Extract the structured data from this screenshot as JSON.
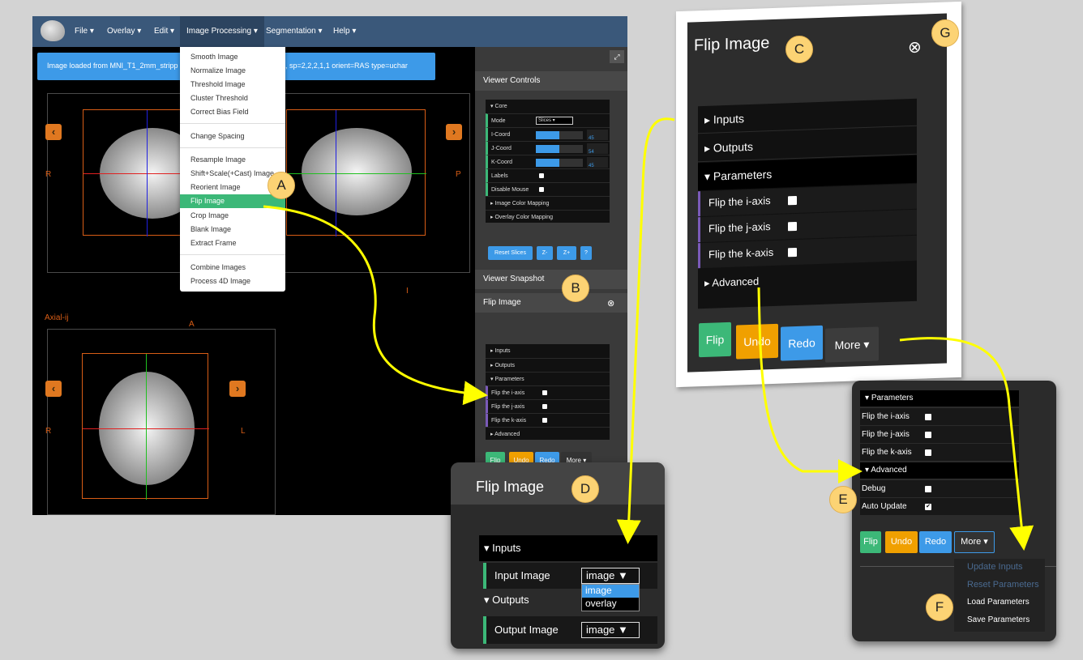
{
  "navbar": {
    "menus": [
      "File",
      "Overlay",
      "Edit",
      "Image Processing",
      "Segmentation",
      "Help"
    ]
  },
  "alert": {
    "text": "Image loaded from MNI_T1_2mm_stripp",
    "text2": ", sp=2,2,2,1,1 orient=RAS type=uchar",
    "close": "×"
  },
  "menu": {
    "group1": [
      "Smooth Image",
      "Normalize Image",
      "Threshold Image",
      "Cluster Threshold",
      "Correct Bias Field"
    ],
    "group2": [
      "Change Spacing"
    ],
    "group3": [
      "Resample Image",
      "Shift+Scale(+Cast) Image",
      "Reorient Image",
      "Flip Image",
      "Crop Image",
      "Blank Image",
      "Extract Frame"
    ],
    "group4": [
      "Combine Images",
      "Process 4D Image"
    ]
  },
  "viewer": {
    "labels": {
      "coronal_left": "R",
      "sagittal_right": "P",
      "sagittal_bottom": "I",
      "axial_title": "Axial-ij",
      "axial_top": "A",
      "axial_left": "R",
      "axial_right": "L"
    }
  },
  "viewer_controls": {
    "title": "Viewer Controls",
    "core": "Core",
    "mode_label": "Mode",
    "mode_value": "Slices",
    "icoord": "I-Coord",
    "jcoord": "J-Coord",
    "kcoord": "K-Coord",
    "ival": "45",
    "jval": "54",
    "kval": "45",
    "labels": "Labels",
    "disable_mouse": "Disable Mouse",
    "image_color": "Image Color Mapping",
    "overlay_color": "Overlay Color Mapping",
    "reset_slices": "Reset Slices",
    "zminus": "Z-",
    "zplus": "Z+",
    "help": "?"
  },
  "snapshot": {
    "title": "Viewer Snapshot"
  },
  "flip_panel": {
    "title": "Flip Image",
    "inputs": "Inputs",
    "outputs": "Outputs",
    "parameters": "Parameters",
    "flip_i": "Flip the i-axis",
    "flip_j": "Flip the j-axis",
    "flip_k": "Flip the k-axis",
    "advanced": "Advanced",
    "flip_btn": "Flip",
    "undo": "Undo",
    "redo": "Redo",
    "more": "More"
  },
  "callout_d": {
    "title": "Flip Image",
    "inputs": "Inputs",
    "input_image": "Input Image",
    "input_value": "image",
    "options": [
      "image",
      "overlay"
    ],
    "outputs": "Outputs",
    "output_image": "Output Image",
    "output_value": "image"
  },
  "callout_ef": {
    "parameters": "Parameters",
    "flip_i": "Flip the i-axis",
    "flip_j": "Flip the j-axis",
    "flip_k": "Flip the k-axis",
    "advanced": "Advanced",
    "debug": "Debug",
    "auto_update": "Auto Update",
    "flip_btn": "Flip",
    "undo": "Undo",
    "redo": "Redo",
    "more": "More",
    "more_menu": [
      "Update Inputs",
      "Reset Parameters",
      "Load Parameters",
      "Save Parameters"
    ]
  },
  "badges": {
    "a": "A",
    "b": "B",
    "c": "C",
    "d": "D",
    "e": "E",
    "f": "F",
    "g": "G"
  },
  "colors": {
    "accent": "#3d9ae8",
    "success": "#3cb878",
    "warning": "#f0a000",
    "callout_arrow": "#ffff00"
  }
}
